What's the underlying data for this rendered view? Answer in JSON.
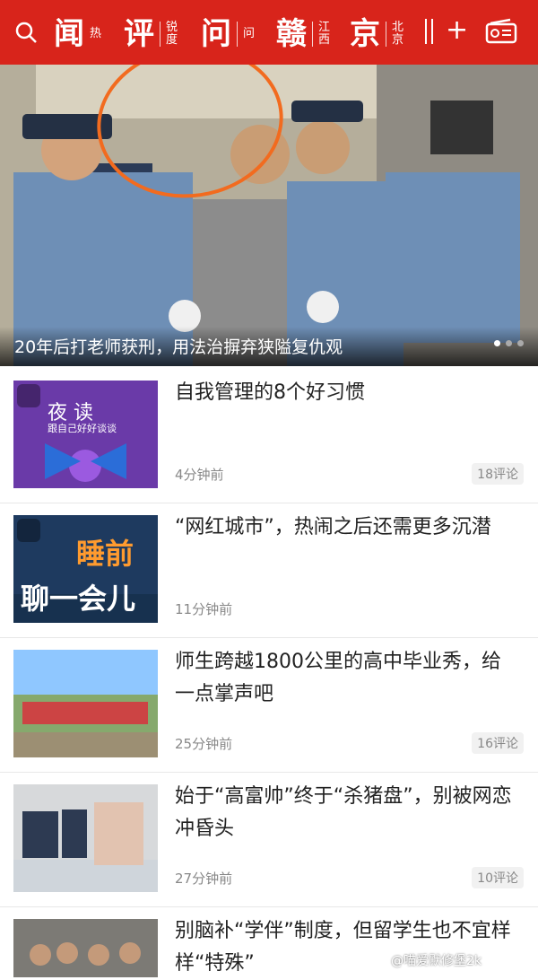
{
  "header": {
    "tabs": [
      {
        "big": "闻",
        "small": [
          "热",
          ""
        ]
      },
      {
        "big": "评",
        "small": [
          "锐",
          "度"
        ]
      },
      {
        "big": "问",
        "small": [
          "问",
          ""
        ]
      },
      {
        "big": "赣",
        "small": [
          "江",
          "西"
        ]
      },
      {
        "big": "京",
        "small": [
          "北",
          "京"
        ]
      }
    ]
  },
  "hero": {
    "title": "20年后打老师获刑，用法治摒弃狭隘复仇观"
  },
  "feed": [
    {
      "title": "自我管理的8个好习惯",
      "time": "4分钟前",
      "comments": "18评论",
      "thumb": {
        "title": "夜 读",
        "subtitle": "跟自己好好谈谈"
      }
    },
    {
      "title": "“网红城市”，热闹之后还需更多沉潜",
      "time": "11分钟前",
      "comments": "",
      "thumb": {
        "title": "睡前",
        "subtitle": "聊一会儿"
      }
    },
    {
      "title": "师生跨越1800公里的高中毕业秀，给一点掌声吧",
      "time": "25分钟前",
      "comments": "16评论"
    },
    {
      "title": "始于“高富帅”终于“杀猪盘”，别被网恋冲昏头",
      "time": "27分钟前",
      "comments": "10评论"
    },
    {
      "title": "别脑补“学伴”制度，但留学生也不宜样样“特殊”",
      "time": "",
      "comments": ""
    }
  ],
  "watermark": "@喵爱默修堡2k"
}
